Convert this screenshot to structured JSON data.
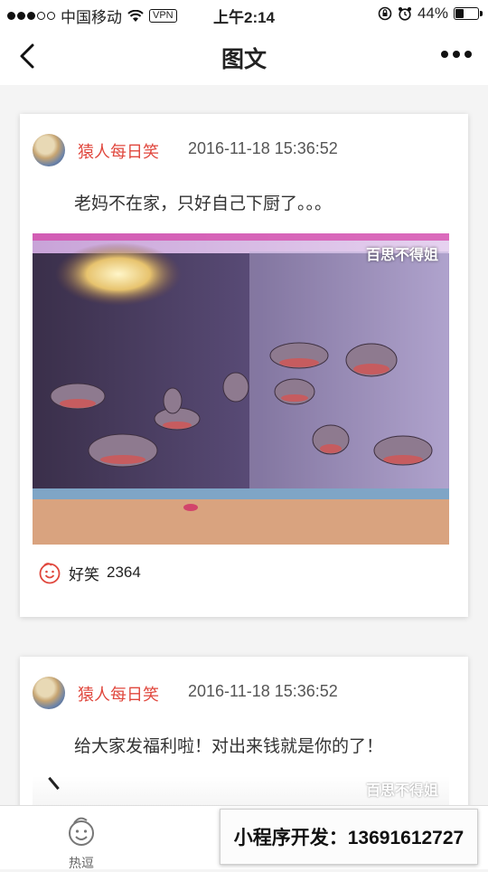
{
  "status_bar": {
    "carrier": "中国移动",
    "vpn": "VPN",
    "time": "上午2:14",
    "battery": "44%",
    "battery_level": 0.44
  },
  "nav": {
    "title": "图文",
    "back_icon": "chevron-left-icon",
    "more_icon": "more-dots-icon"
  },
  "posts": [
    {
      "author": "猿人每日笑",
      "date": "2016-11-18 15:36:52",
      "text": "老妈不在家，只好自己下厨了。。。",
      "watermark": "百思不得姐",
      "reaction_label": "好笑",
      "reaction_count": "2364"
    },
    {
      "author": "猿人每日笑",
      "date": "2016-11-18 15:36:52",
      "text": "给大家发福利啦！对出来钱就是你的了！",
      "watermark": "百思不得姐"
    }
  ],
  "tabbar": {
    "tabs": [
      {
        "label": "热逗",
        "icon": "face-icon"
      }
    ]
  },
  "promo": {
    "text": "小程序开发：13691612727"
  },
  "colors": {
    "accent": "#e0473d",
    "background": "#f4f4f4"
  }
}
